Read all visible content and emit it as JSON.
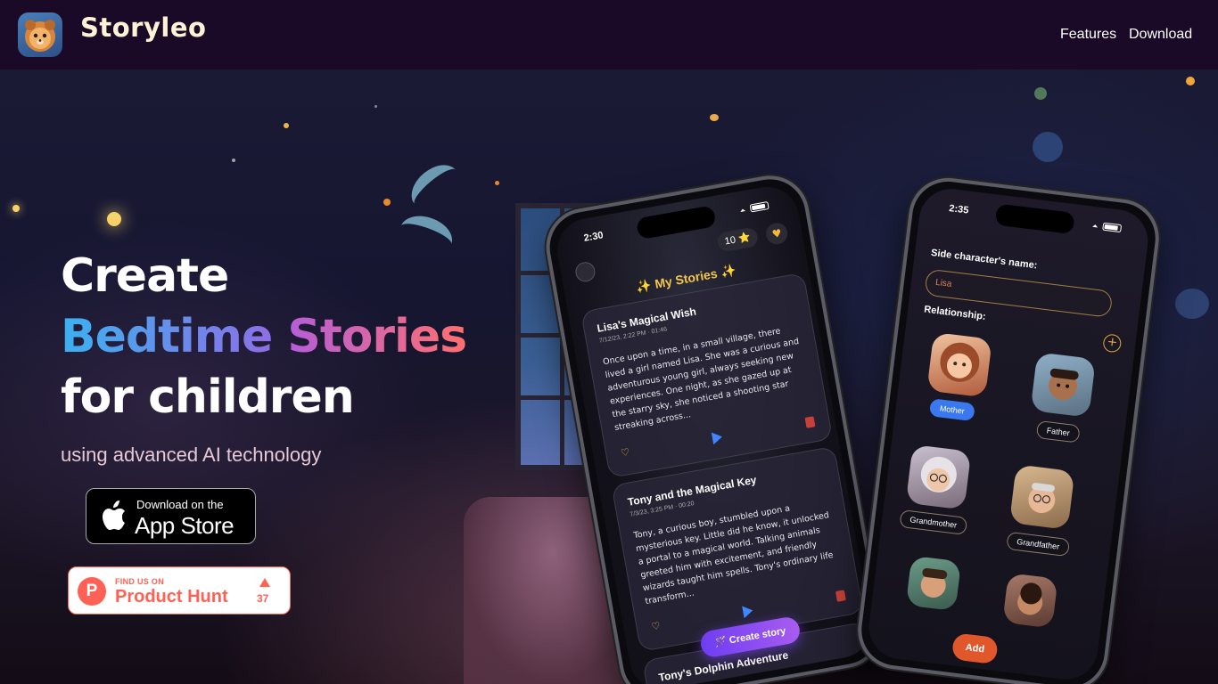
{
  "nav": {
    "brand": "Storyleo",
    "links": [
      "Features",
      "Download"
    ]
  },
  "hero": {
    "line1": "Create",
    "line2a": "Bedtime",
    "line2b": "Stories",
    "line3": "for children",
    "subline": "using advanced AI technology",
    "appstore": {
      "small": "Download on the",
      "big": "App Store"
    },
    "producthunt": {
      "small": "FIND US ON",
      "big": "Product Hunt",
      "votes": "37"
    }
  },
  "phone1": {
    "time": "2:30",
    "stars": "10 ⭐",
    "title": "✨ My Stories ✨",
    "stories": [
      {
        "title": "Lisa's Magical Wish",
        "meta": "7/12/23, 2:22 PM  ·  01:46",
        "body": "Once upon a time, in a small village, there lived a girl named Lisa. She was a curious and adventurous young girl, always seeking new experiences. One night, as she gazed up at the starry sky, she noticed a shooting star streaking across..."
      },
      {
        "title": "Tony and the Magical Key",
        "meta": "7/3/23, 3:25 PM  ·  00:20",
        "body": "Tony, a curious boy, stumbled upon a mysterious key. Little did he know, it unlocked a portal to a magical world. Talking animals greeted him with excitement, and friendly wizards taught him spells. Tony's ordinary life transform..."
      },
      {
        "title": "Tony's Dolphin Adventure"
      }
    ],
    "create_button": "🪄 Create story"
  },
  "phone2": {
    "time": "2:35",
    "name_label": "Side character's name:",
    "name_value": "Lisa",
    "relationship_label": "Relationship:",
    "relations": [
      "Mother",
      "Father",
      "Grandmother",
      "Grandfather"
    ],
    "add_button": "Add"
  },
  "colors": {
    "nav_bg": "#1b0a27",
    "gradient_blue": "#3bb1f0",
    "gradient_pink": "#ff6f6f",
    "ph_orange": "#ff6154",
    "accent_blue": "#3a78f0",
    "add_orange": "#e0572b"
  }
}
